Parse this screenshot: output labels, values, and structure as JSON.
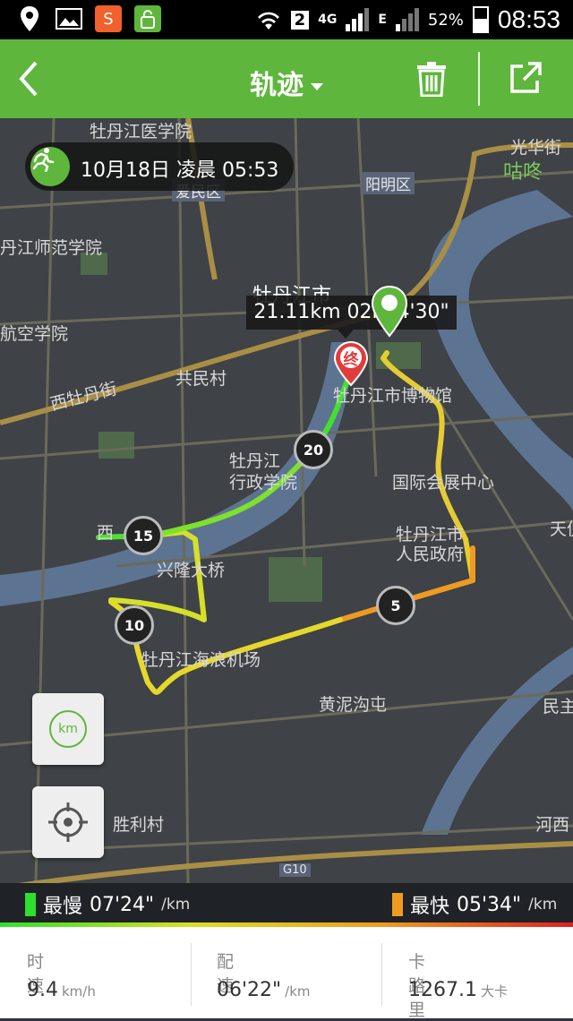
{
  "status_bar": {
    "battery_text": "52%",
    "time": "08:53",
    "network": "4G",
    "sim_slot": "2",
    "e_label": "E"
  },
  "header": {
    "title": "轨迹",
    "color": "#5fb63d"
  },
  "map": {
    "date_chip": "10月18日 凌晨 05:53",
    "tooltip": "21.11km  02h14'30\"",
    "end_marker": "终",
    "km_markers": [
      "20",
      "15",
      "10",
      "5"
    ],
    "labels": {
      "medical": "牡丹江医学院",
      "normal": "丹江师范学院",
      "aviation": "航空学院",
      "street": "西牡丹街",
      "gongmin": "共民村",
      "city": "牡丹江市",
      "museum": "牡丹江市博物馆",
      "admin1": "牡丹江",
      "admin2": "行政学院",
      "expo": "国际会展中心",
      "gov1": "牡丹江市",
      "gov2": "人民政府",
      "bridge": "兴隆大桥",
      "xi": "西",
      "airport": "牡丹江海浪机场",
      "huangni": "黄泥沟屯",
      "shengli": "胜利村",
      "hexi": "河西",
      "minzhu": "民主",
      "tianxing": "天倪",
      "guanghua": "光华街",
      "gudong": "咕咚",
      "district_yangming": "阳明区",
      "district_aimin": "爱民区",
      "g10": "G10"
    },
    "buttons": {
      "km": "km"
    }
  },
  "legend": {
    "slow_label": "最慢",
    "slow_value": "07'24\"",
    "fast_label": "最快",
    "fast_value": "05'34\"",
    "unit": "/km",
    "slow_color": "#2ee02e",
    "fast_color": "#f09a20"
  },
  "stats": [
    {
      "label": "时速",
      "value": "9.4",
      "unit": "km/h"
    },
    {
      "label": "配速",
      "value": "06'22\"",
      "unit": "/km"
    },
    {
      "label": "卡路里",
      "value": "1267.1",
      "unit": "大卡"
    }
  ]
}
